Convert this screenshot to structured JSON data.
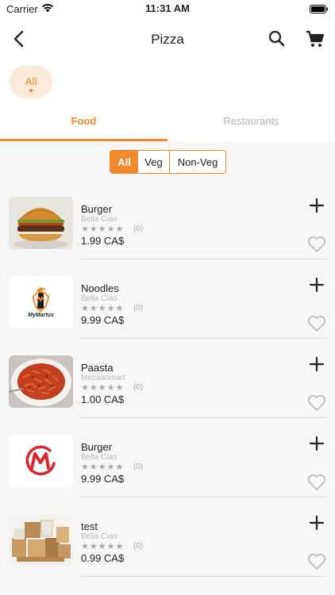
{
  "status_bar": {
    "carrier": "Carrier",
    "time": "11:31 AM"
  },
  "nav": {
    "title": "Pizza",
    "back_icon": "chevron-left-icon",
    "search_icon": "search-icon",
    "cart_icon": "cart-icon"
  },
  "category": {
    "label": "All"
  },
  "tabs": [
    {
      "label": "Food",
      "active": true
    },
    {
      "label": "Restaurants",
      "active": false
    }
  ],
  "filter": {
    "options": [
      "All",
      "Veg",
      "Non-Veg"
    ],
    "selected": "All"
  },
  "items": [
    {
      "name": "Burger",
      "restaurant": "Bella Ciao",
      "rating_stars": "★★★★★",
      "rating_count": "(0)",
      "price": "1.99 CA$",
      "image": "burger-photo"
    },
    {
      "name": "Noodles",
      "restaurant": "Bella Ciao",
      "rating_stars": "★★★★★",
      "rating_count": "(0)",
      "price": "9.99 CA$",
      "image": "mymartus-logo",
      "logo_text": "MyMartus"
    },
    {
      "name": "Paasta",
      "restaurant": "Mezaanmart",
      "rating_stars": "★★★★★",
      "rating_count": "(0)",
      "price": "1.00 CA$",
      "image": "pasta-photo"
    },
    {
      "name": "Burger",
      "restaurant": "Bella Ciao",
      "rating_stars": "★★★★★",
      "rating_count": "(0)",
      "price": "9.99 CA$",
      "image": "m-logo"
    },
    {
      "name": "test",
      "restaurant": "Bella Ciao",
      "rating_stars": "★★★★★",
      "rating_count": "(0)",
      "price": "0.99 CA$",
      "image": "boxes-photo"
    }
  ],
  "colors": {
    "accent": "#f08a2c",
    "chip_bg": "#fdeadb",
    "muted": "#b5b5b5",
    "list_bg": "#f7f7f7"
  }
}
